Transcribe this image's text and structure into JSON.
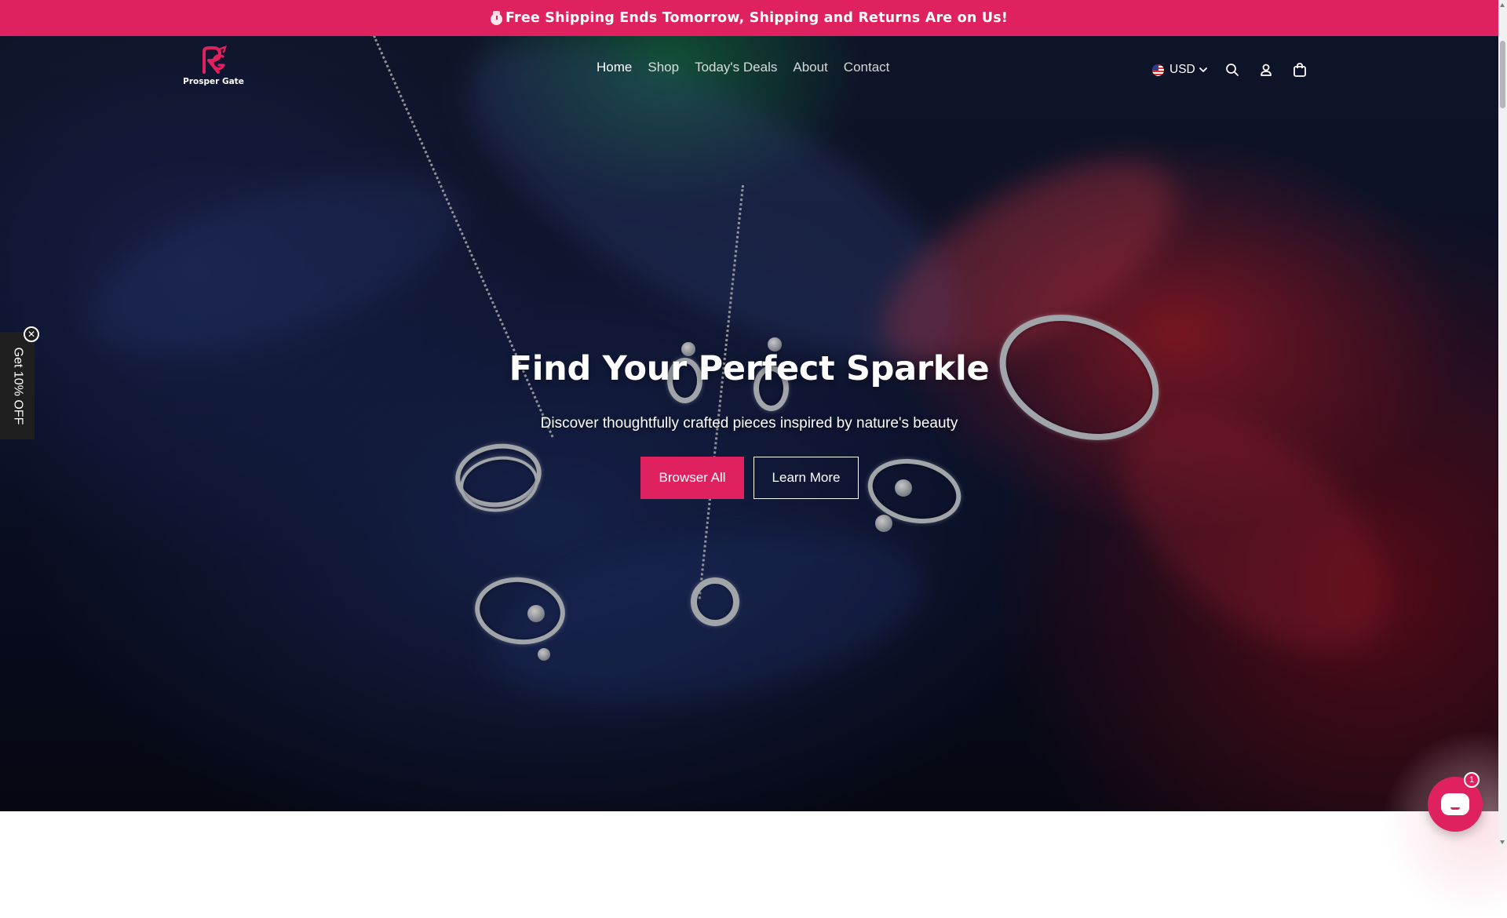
{
  "announcement": {
    "text": "Free Shipping Ends Tomorrow, Shipping and Returns Are on Us!",
    "icon": "alarm-clock-icon"
  },
  "brand": {
    "name": "Prosper Gate",
    "accent_color": "#e0215f"
  },
  "nav": {
    "items": [
      {
        "label": "Home",
        "active": true
      },
      {
        "label": "Shop",
        "active": false
      },
      {
        "label": "Today's Deals",
        "active": false
      },
      {
        "label": "About",
        "active": false
      },
      {
        "label": "Contact",
        "active": false
      }
    ]
  },
  "header_utils": {
    "currency": "USD",
    "icons": [
      "us-flag-icon",
      "chevron-down-icon",
      "search-icon",
      "account-icon",
      "cart-icon"
    ]
  },
  "hero": {
    "title": "Find Your Perfect Sparkle",
    "subtitle": "Discover thoughtfully crafted pieces inspired by nature's beauty",
    "primary_button": "Browser All",
    "secondary_button": "Learn More"
  },
  "discount_tab": {
    "label": "Get 10% OFF",
    "close_symbol": "✕"
  },
  "chat": {
    "badge_count": "1",
    "icon": "chat-icon"
  }
}
